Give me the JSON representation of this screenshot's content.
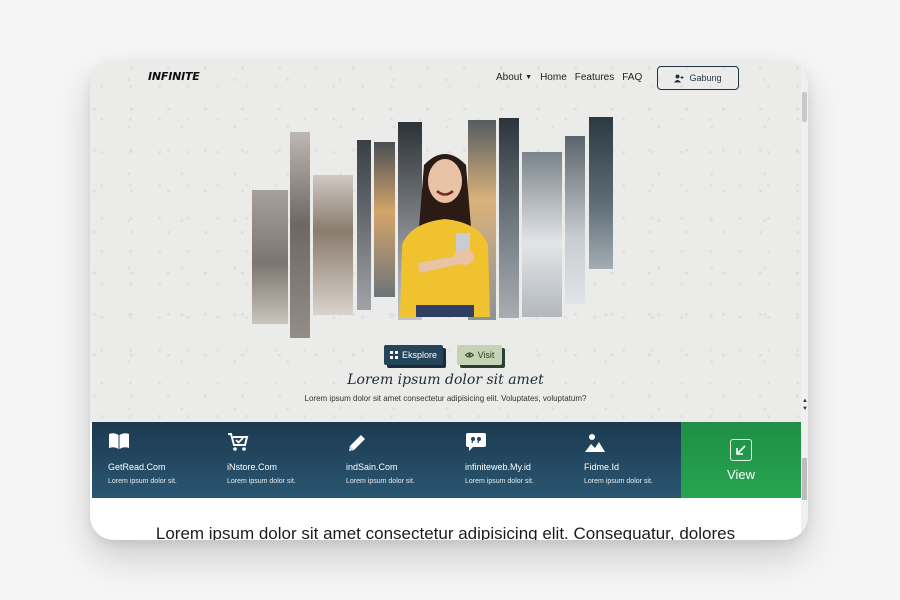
{
  "nav": {
    "logo": "INFINITE",
    "items": [
      {
        "label": "About",
        "has_dropdown": true
      },
      {
        "label": "Home"
      },
      {
        "label": "Features"
      },
      {
        "label": "FAQ"
      }
    ],
    "join_button": {
      "label": "Gabung",
      "icon": "user-plus-icon"
    }
  },
  "hero": {
    "buttons": [
      {
        "label": "Eksplore",
        "icon": "grid-icon"
      },
      {
        "label": "Visit",
        "icon": "eye-icon"
      }
    ],
    "title": "Lorem ipsum dolor sit amet",
    "subtitle": "Lorem ipsum dolor sit amet consectetur adipisicing elit. Voluptates, voluptatum?"
  },
  "features": [
    {
      "name": "GetRead.Com",
      "desc": "Lorem ipsum dolor sit.",
      "icon": "book-icon"
    },
    {
      "name": "iNstore.Com",
      "desc": "Lorem ipsum dolor sit.",
      "icon": "cart-icon"
    },
    {
      "name": "indSain.Com",
      "desc": "Lorem ipsum dolor sit.",
      "icon": "pencil-icon"
    },
    {
      "name": "infiniteweb.My.id",
      "desc": "Lorem ipsum dolor sit.",
      "icon": "quote-icon"
    },
    {
      "name": "Fidme.Id",
      "desc": "Lorem ipsum dolor sit.",
      "icon": "image-icon"
    }
  ],
  "view_card": {
    "label": "View",
    "icon": "arrow-down-left-icon"
  },
  "lower_text": "Lorem ipsum dolor sit amet consectetur adipisicing elit. Consequatur, dolores",
  "colors": {
    "navy": "#24445a",
    "sage": "#c5d3b4",
    "green": "#27a450",
    "feature_bar": "#1c3a51"
  }
}
